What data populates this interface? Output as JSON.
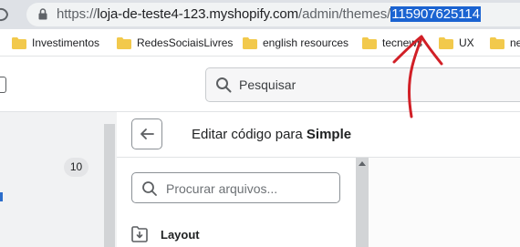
{
  "browser": {
    "url": {
      "scheme": "https://",
      "host": "loja-de-teste4-123.myshopify.com",
      "path": "/admin/themes/",
      "selected": "115907625114"
    },
    "bookmarks": [
      {
        "label": "Investimentos"
      },
      {
        "label": "RedesSociaisLivres"
      },
      {
        "label": "english resources"
      },
      {
        "label": "tecnews"
      },
      {
        "label": "UX"
      },
      {
        "label": "ne"
      }
    ]
  },
  "topbar": {
    "search_placeholder": "Pesquisar"
  },
  "leftnav": {
    "badge_count": "10"
  },
  "editor": {
    "title_prefix": "Editar código para ",
    "theme_name": "Simple",
    "file_search_placeholder": "Procurar arquivos...",
    "folders": [
      {
        "label": "Layout"
      }
    ]
  },
  "colors": {
    "selection": "#1a63d1",
    "annotation": "#d11f26",
    "folder": "#f2c94c"
  }
}
